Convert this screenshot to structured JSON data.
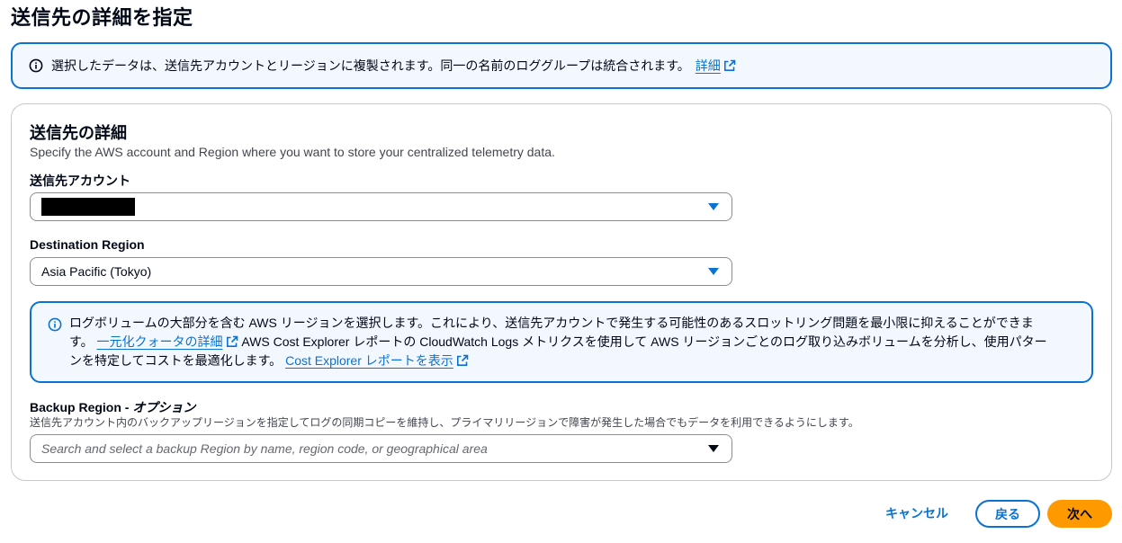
{
  "page": {
    "title": "送信先の詳細を指定"
  },
  "top_info": {
    "text": "選択したデータは、送信先アカウントとリージョンに複製されます。同一の名前のロググループは統合されます。",
    "link": "詳細"
  },
  "details": {
    "title": "送信先の詳細",
    "description": "Specify the AWS account and Region where you want to store your centralized telemetry data.",
    "account_label": "送信先アカウント",
    "region_label": "Destination Region",
    "region_value": "Asia Pacific (Tokyo)",
    "info": {
      "text1": "ログボリュームの大部分を含む AWS リージョンを選択します。これにより、送信先アカウントで発生する可能性のあるスロットリング問題を最小限に抑えることができます。",
      "link1": "一元化クォータの詳細",
      "text2": "AWS Cost Explorer レポートの CloudWatch Logs メトリクスを使用して AWS リージョンごとのログ取り込みボリュームを分析し、使用パターンを特定してコストを最適化します。",
      "link2": "Cost Explorer レポートを表示"
    },
    "backup_label": "Backup Region - ",
    "backup_optional": "オプション",
    "backup_description": "送信先アカウント内のバックアップリージョンを指定してログの同期コピーを維持し、プライマリリージョンで障害が発生した場合でもデータを利用できるようにします。",
    "backup_placeholder": "Search and select a backup Region by name, region code, or geographical area"
  },
  "actions": {
    "cancel": "キャンセル",
    "back": "戻る",
    "next": "次へ"
  },
  "colors": {
    "accent": "#0972d3",
    "primary_button": "#ff9900",
    "info_bg": "#f2f8fd"
  },
  "icons": [
    "info-icon",
    "external-link-icon",
    "caret-down-icon"
  ]
}
